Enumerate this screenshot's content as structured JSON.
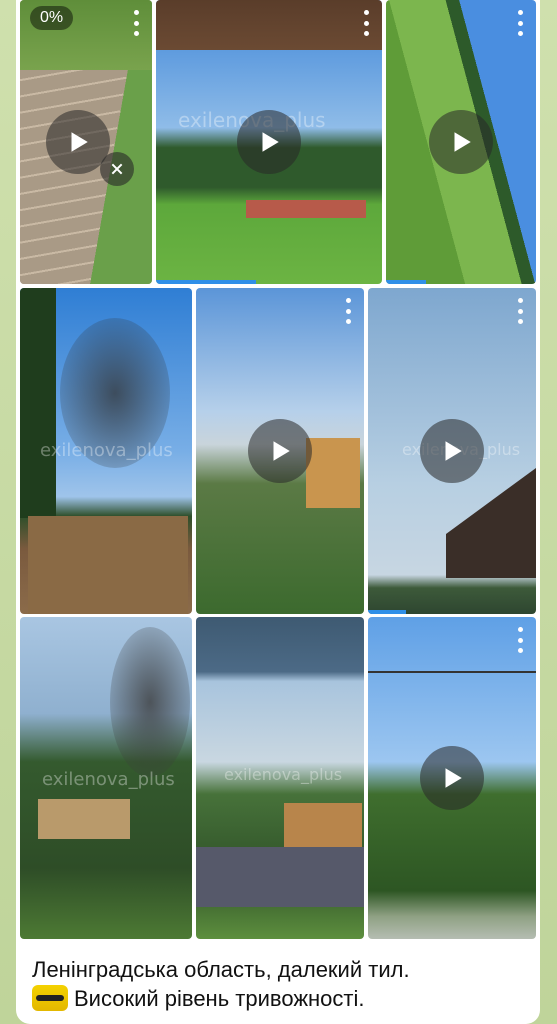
{
  "media_grid": {
    "download_progress": "0%",
    "watermark": "exilenova_plus",
    "tiles": [
      {
        "id": 1,
        "type": "video"
      },
      {
        "id": 2,
        "type": "video"
      },
      {
        "id": 3,
        "type": "video"
      },
      {
        "id": 4,
        "type": "photo"
      },
      {
        "id": 5,
        "type": "video"
      },
      {
        "id": 6,
        "type": "video"
      },
      {
        "id": 7,
        "type": "photo"
      },
      {
        "id": 8,
        "type": "photo"
      },
      {
        "id": 9,
        "type": "video"
      }
    ]
  },
  "icons": {
    "play": "play-icon",
    "menu": "more-vertical-icon",
    "cancel": "close-icon",
    "emoji": "warning-siren-emoji"
  },
  "caption": {
    "line1": "Ленінградська область, далекий тил.",
    "line2": "Високий рівень тривожності."
  },
  "colors": {
    "wallpaper": "#c9dba8",
    "bubble": "#ffffff",
    "progress_bar": "#2f8fe8"
  }
}
